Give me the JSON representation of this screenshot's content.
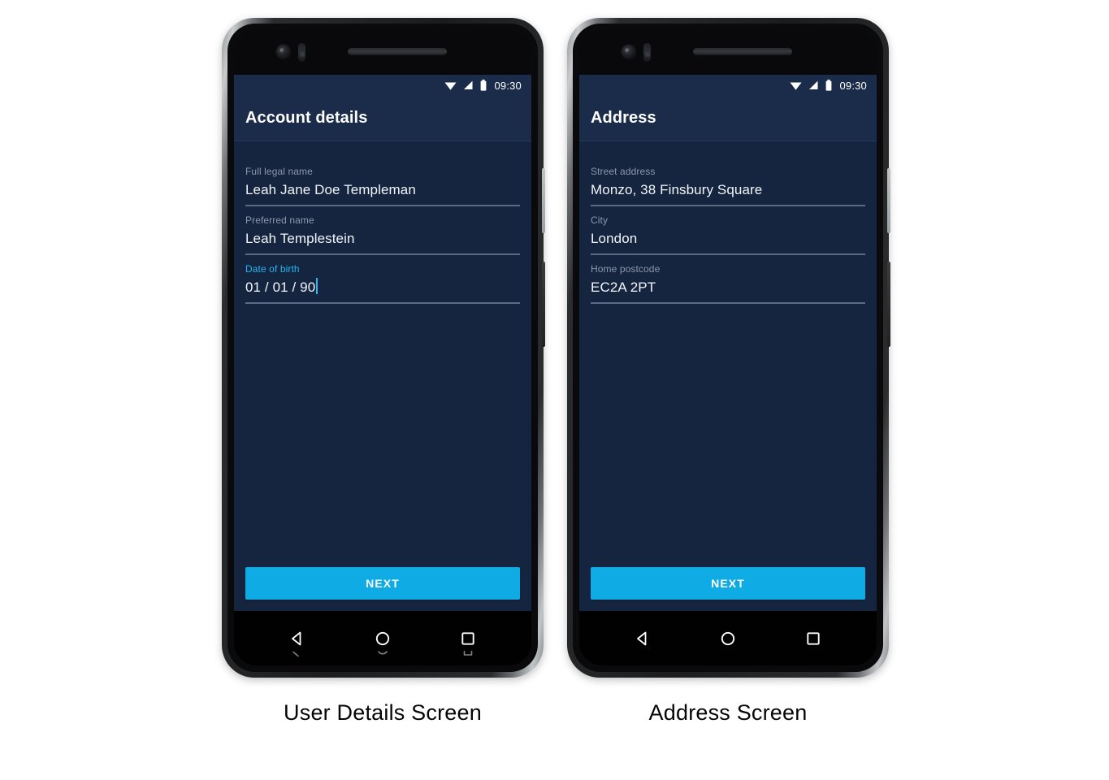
{
  "page": {
    "background": "#ffffff",
    "accent_color": "#0fabe5",
    "screen_background": "#152540",
    "app_bar_background": "#1b2c4a",
    "label_color": "#8d97a8",
    "active_label_color": "#23b5ef",
    "underline_color": "#5a6b82"
  },
  "phones": [
    {
      "caption": "User Details Screen",
      "status_bar": {
        "time": "09:30",
        "icons": [
          "wifi-icon",
          "signal-icon",
          "battery-icon"
        ]
      },
      "app_bar": {
        "title": "Account details"
      },
      "fields": [
        {
          "label": "Full legal name",
          "value": "Leah Jane Doe Templeman",
          "active": false,
          "caret": false
        },
        {
          "label": "Preferred name",
          "value": "Leah Templestein",
          "active": false,
          "caret": false
        },
        {
          "label": "Date of birth",
          "value": "01 / 01 / 90",
          "active": true,
          "caret": true
        }
      ],
      "primary_button": {
        "label": "NEXT"
      },
      "nav_bar": {
        "back": "back-icon",
        "home": "home-icon",
        "recents": "recents-icon",
        "has_ghost_reflection": true
      }
    },
    {
      "caption": "Address Screen",
      "status_bar": {
        "time": "09:30",
        "icons": [
          "wifi-icon",
          "signal-icon",
          "battery-icon"
        ]
      },
      "app_bar": {
        "title": "Address"
      },
      "fields": [
        {
          "label": "Street address",
          "value": "Monzo, 38 Finsbury Square",
          "active": false,
          "caret": false
        },
        {
          "label": "City",
          "value": "London",
          "active": false,
          "caret": false
        },
        {
          "label": "Home postcode",
          "value": "EC2A 2PT",
          "active": false,
          "caret": false
        }
      ],
      "primary_button": {
        "label": "NEXT"
      },
      "nav_bar": {
        "back": "back-icon",
        "home": "home-icon",
        "recents": "recents-icon",
        "has_ghost_reflection": false
      }
    }
  ]
}
